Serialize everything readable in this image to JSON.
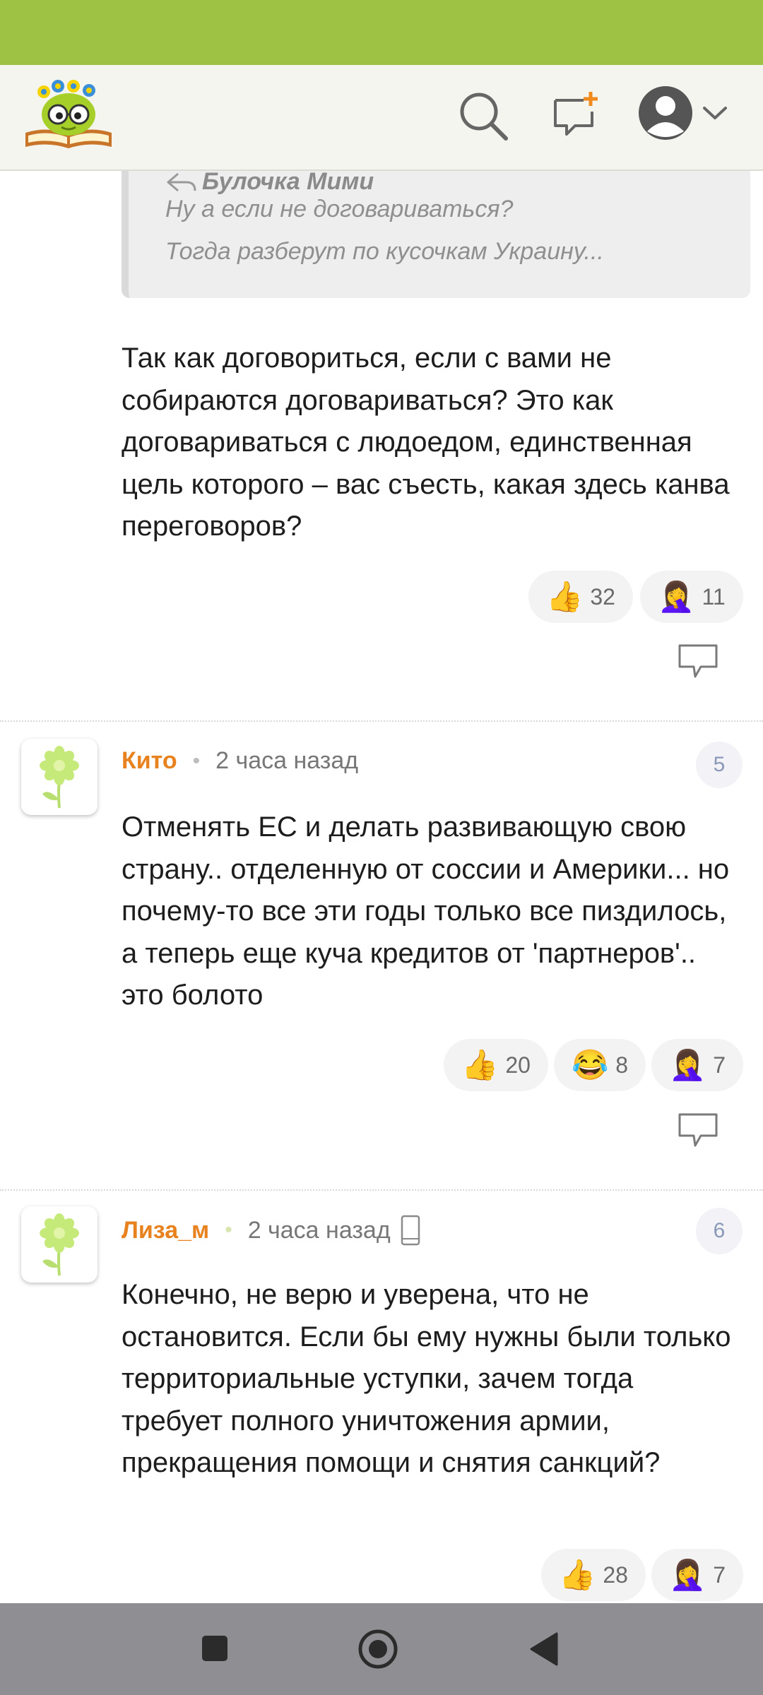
{
  "header": {
    "logo_icon": "bookworm-logo-icon",
    "icons": [
      "search-icon",
      "new-post-icon",
      "profile-avatar-icon",
      "chevron-down-icon"
    ]
  },
  "colors": {
    "status_bar": "#9dc244",
    "author_name": "#e8821e",
    "text": "#1d1d1d"
  },
  "quote": {
    "author": "Булочка Мими",
    "lines": [
      "Ну а если не договариваться?",
      "Тогда разберут по кусочкам Украину..."
    ]
  },
  "comments": [
    {
      "text": "Так как договориться, если с вами не собираются договариваться? Это как договариваться с людоедом, единственная цель которого – вас съесть, какая здесь канва переговоров?",
      "reactions": [
        {
          "icon": "thumbs-up-icon",
          "emoji": "👍",
          "count": "32"
        },
        {
          "icon": "facepalm-icon",
          "emoji": "🤦‍♀️",
          "count": "11"
        }
      ]
    },
    {
      "author": "Кито",
      "time": "2 часа назад",
      "number": "5",
      "text": "Отменять ЕС и делать развивающую свою страну.. отделенную от соссии и Америки... но почему-то все эти годы только все пиздилось, а теперь еще куча кредитов от 'партнеров'.. это болото",
      "reactions": [
        {
          "icon": "thumbs-up-icon",
          "emoji": "👍",
          "count": "20"
        },
        {
          "icon": "laughing-icon",
          "emoji": "😂",
          "count": "8"
        },
        {
          "icon": "facepalm-icon",
          "emoji": "🤦‍♀️",
          "count": "7"
        }
      ]
    },
    {
      "author": "Лиза_м",
      "time": "2 часа назад",
      "number": "6",
      "text": "Конечно, не верю и уверена, что не остановится. Если бы ему нужны были только территориальные уступки, зачем тогда требует полного уничтожения армии, прекращения помощи и снятия санкций?",
      "reactions": [
        {
          "icon": "thumbs-up-icon",
          "emoji": "👍",
          "count": "28"
        },
        {
          "icon": "facepalm-icon",
          "emoji": "🤦‍♀️",
          "count": "7"
        }
      ]
    }
  ],
  "nav": {
    "icons": [
      "recent-apps-icon",
      "home-icon",
      "back-icon"
    ]
  }
}
